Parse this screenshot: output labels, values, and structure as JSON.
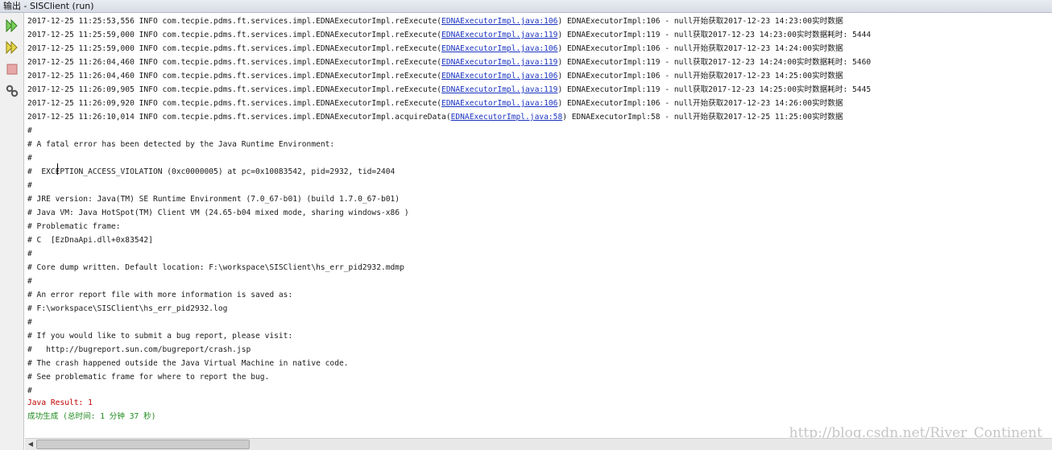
{
  "window": {
    "title": "输出 - SISClient (run)"
  },
  "toolbar": {
    "buttons": [
      {
        "icon": "rerun-icon"
      },
      {
        "icon": "rerun-with-parameters-icon"
      },
      {
        "icon": "stop-icon"
      },
      {
        "icon": "settings-icon"
      }
    ]
  },
  "output": {
    "log_lines": [
      {
        "pre": "2017-12-25 11:25:53,556 INFO com.tecpie.pdms.ft.services.impl.EDNAExecutorImpl.reExecute(",
        "link": "EDNAExecutorImpl.java:106",
        "post": ") EDNAExecutorImpl:106 - null开始获取2017-12-23 14:23:00实时数据"
      },
      {
        "pre": "2017-12-25 11:25:59,000 INFO com.tecpie.pdms.ft.services.impl.EDNAExecutorImpl.reExecute(",
        "link": "EDNAExecutorImpl.java:119",
        "post": ") EDNAExecutorImpl:119 - null获取2017-12-23 14:23:00实时数据耗时: 5444"
      },
      {
        "pre": "2017-12-25 11:25:59,000 INFO com.tecpie.pdms.ft.services.impl.EDNAExecutorImpl.reExecute(",
        "link": "EDNAExecutorImpl.java:106",
        "post": ") EDNAExecutorImpl:106 - null开始获取2017-12-23 14:24:00实时数据"
      },
      {
        "pre": "2017-12-25 11:26:04,460 INFO com.tecpie.pdms.ft.services.impl.EDNAExecutorImpl.reExecute(",
        "link": "EDNAExecutorImpl.java:119",
        "post": ") EDNAExecutorImpl:119 - null获取2017-12-23 14:24:00实时数据耗时: 5460"
      },
      {
        "pre": "2017-12-25 11:26:04,460 INFO com.tecpie.pdms.ft.services.impl.EDNAExecutorImpl.reExecute(",
        "link": "EDNAExecutorImpl.java:106",
        "post": ") EDNAExecutorImpl:106 - null开始获取2017-12-23 14:25:00实时数据"
      },
      {
        "pre": "2017-12-25 11:26:09,905 INFO com.tecpie.pdms.ft.services.impl.EDNAExecutorImpl.reExecute(",
        "link": "EDNAExecutorImpl.java:119",
        "post": ") EDNAExecutorImpl:119 - null获取2017-12-23 14:25:00实时数据耗时: 5445"
      },
      {
        "pre": "2017-12-25 11:26:09,920 INFO com.tecpie.pdms.ft.services.impl.EDNAExecutorImpl.reExecute(",
        "link": "EDNAExecutorImpl.java:106",
        "post": ") EDNAExecutorImpl:106 - null开始获取2017-12-23 14:26:00实时数据"
      },
      {
        "pre": "2017-12-25 11:26:10,014 INFO com.tecpie.pdms.ft.services.impl.EDNAExecutorImpl.acquireData(",
        "link": "EDNAExecutorImpl.java:58",
        "post": ") EDNAExecutorImpl:58 - null开始获取2017-12-25 11:25:00实时数据"
      }
    ],
    "crash_lines": [
      "#",
      "# A fatal error has been detected by the Java Runtime Environment:",
      "#",
      "#  EXCEPTION_ACCESS_VIOLATION (0xc0000005) at pc=0x10083542, pid=2932, tid=2404",
      "#",
      "# JRE version: Java(TM) SE Runtime Environment (7.0_67-b01) (build 1.7.0_67-b01)",
      "# Java VM: Java HotSpot(TM) Client VM (24.65-b04 mixed mode, sharing windows-x86 )",
      "# Problematic frame:",
      "# C  [EzDnaApi.dll+0x83542]",
      "#",
      "# Core dump written. Default location: F:\\workspace\\SISClient\\hs_err_pid2932.mdmp",
      "#",
      "# An error report file with more information is saved as:",
      "# F:\\workspace\\SISClient\\hs_err_pid2932.log",
      "#",
      "# If you would like to submit a bug report, please visit:",
      "#   http://bugreport.sun.com/bugreport/crash.jsp",
      "# The crash happened outside the Java Virtual Machine in native code.",
      "# See problematic frame for where to report the bug.",
      "#"
    ],
    "result_line": "Java Result: 1",
    "build_line": "成功生成 (总时间: 1 分钟 37 秒)"
  },
  "watermark": "http://blog.csdn.net/River_Continent",
  "colors": {
    "link": "#1a33c0",
    "error": "#c00000",
    "success": "#1d8a1d",
    "rerun_green": "#3aa52d"
  }
}
